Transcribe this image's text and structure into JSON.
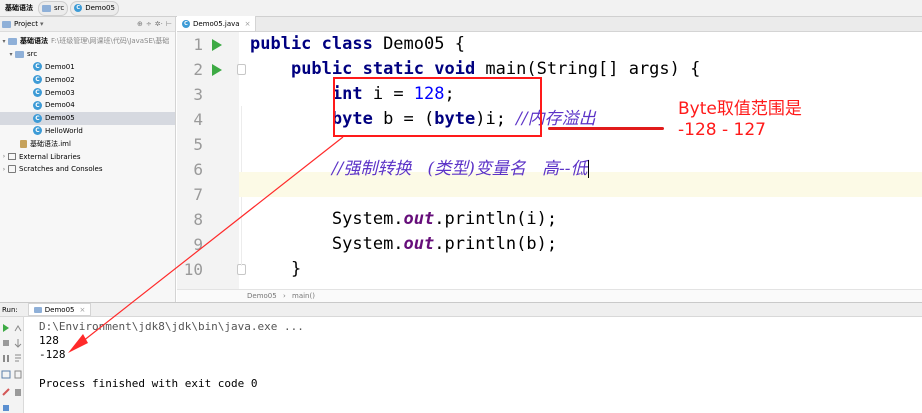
{
  "breadcrumb": {
    "project": "基础语法",
    "folder": "src",
    "file": "Demo05"
  },
  "sidebar": {
    "header_label": "Project",
    "header_tools": [
      "⊕",
      "÷",
      "✲·",
      "⊢"
    ],
    "root": {
      "name": "基础语法",
      "path": "F:\\班级管理\\网课班\\代码\\JavaSE\\基础"
    },
    "src": "src",
    "classes": [
      "Demo01",
      "Demo02",
      "Demo03",
      "Demo04",
      "Demo05",
      "HelloWorld"
    ],
    "selected": "Demo05",
    "iml": "基础语法.iml",
    "external": "External Libraries",
    "scratches": "Scratches and Consoles"
  },
  "editor": {
    "tab_label": "Demo05.java",
    "line_numbers": [
      "1",
      "2",
      "3",
      "4",
      "5",
      "6",
      "7",
      "8",
      "9",
      "10"
    ],
    "code": {
      "l1_kw": "public class",
      "l1_rest": " Demo05 {",
      "l2_kw1": "public static void",
      "l2_rest": " main(String[] args) {",
      "l3_kw": "int",
      "l3_mid": " i = ",
      "l3_num": "128",
      "l3_end": ";",
      "l4_kw": "byte",
      "l4_mid": " b = (",
      "l4_kw2": "byte",
      "l4_end": ")i; ",
      "l4_comment": "//内存溢出",
      "l6_comment": "//强制转换   (类型)变量名   高--低",
      "l8_pre": "System.",
      "l8_fld": "out",
      "l8_post": ".println(i);",
      "l9_pre": "System.",
      "l9_fld": "out",
      "l9_post": ".println(b);",
      "l10": "}"
    },
    "status_breadcrumb": [
      "Demo05",
      "main()"
    ]
  },
  "run": {
    "label": "Run:",
    "tab_label": "Demo05",
    "console": [
      "D:\\Environment\\jdk8\\jdk\\bin\\java.exe ...",
      "128",
      "-128",
      "",
      "Process finished with exit code 0"
    ]
  },
  "annotation": {
    "line1": "Byte取值范围是",
    "line2": "-128 - 127",
    "color": "#ff1a1a"
  }
}
